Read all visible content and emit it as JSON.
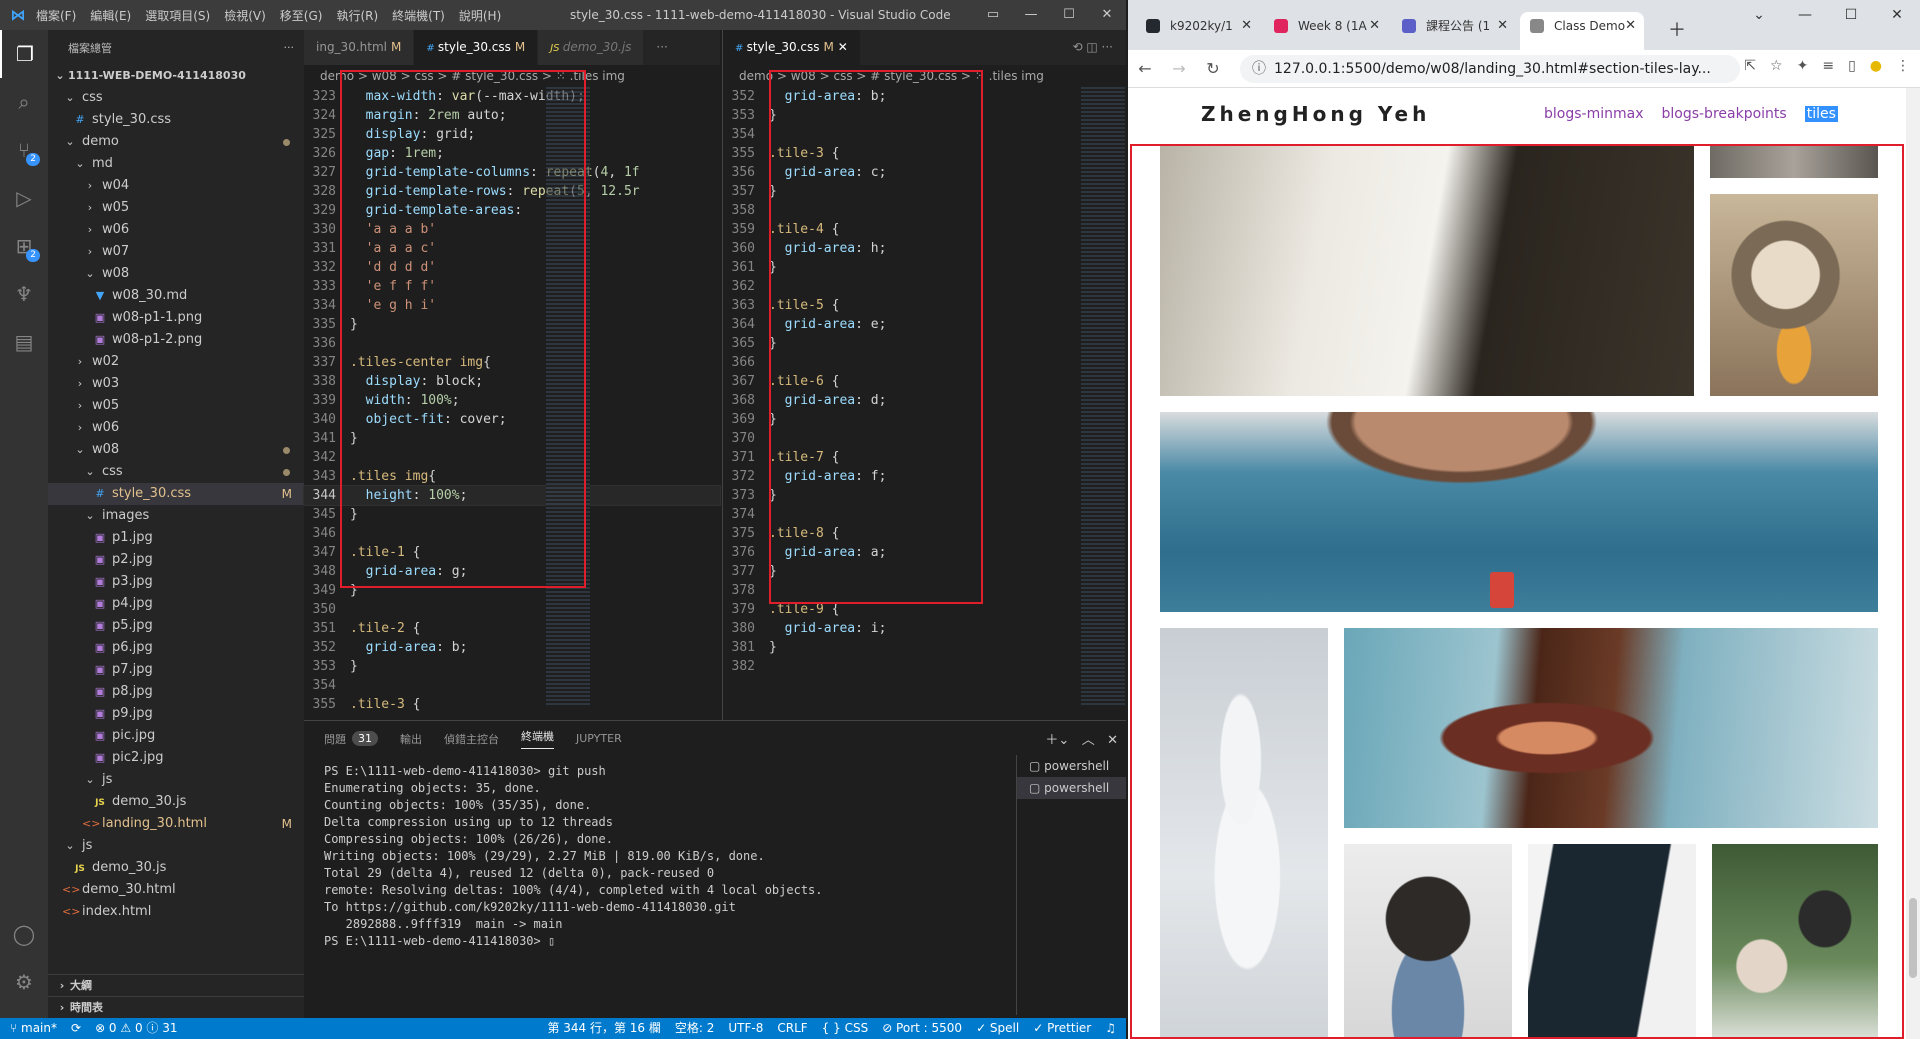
{
  "vscode": {
    "window_title": "style_30.css - 1111-web-demo-411418030 - Visual Studio Code",
    "menu": [
      "檔案(F)",
      "編輯(E)",
      "選取項目(S)",
      "檢視(V)",
      "移至(G)",
      "執行(R)",
      "終端機(T)",
      "說明(H)"
    ],
    "explorer_title": "檔案總管",
    "project": "1111-WEB-DEMO-411418030",
    "tree": [
      {
        "label": "css",
        "indent": 1,
        "type": "folder-open"
      },
      {
        "label": "style_30.css",
        "indent": 2,
        "type": "css"
      },
      {
        "label": "demo",
        "indent": 1,
        "type": "folder-open",
        "dot": true
      },
      {
        "label": "md",
        "indent": 2,
        "type": "folder-open"
      },
      {
        "label": "w04",
        "indent": 3,
        "type": "folder"
      },
      {
        "label": "w05",
        "indent": 3,
        "type": "folder"
      },
      {
        "label": "w06",
        "indent": 3,
        "type": "folder"
      },
      {
        "label": "w07",
        "indent": 3,
        "type": "folder"
      },
      {
        "label": "w08",
        "indent": 3,
        "type": "folder-open"
      },
      {
        "label": "w08_30.md",
        "indent": 4,
        "type": "md"
      },
      {
        "label": "w08-p1-1.png",
        "indent": 4,
        "type": "img"
      },
      {
        "label": "w08-p1-2.png",
        "indent": 4,
        "type": "img"
      },
      {
        "label": "w02",
        "indent": 2,
        "type": "folder"
      },
      {
        "label": "w03",
        "indent": 2,
        "type": "folder"
      },
      {
        "label": "w05",
        "indent": 2,
        "type": "folder"
      },
      {
        "label": "w06",
        "indent": 2,
        "type": "folder"
      },
      {
        "label": "w08",
        "indent": 2,
        "type": "folder-open",
        "dot": true
      },
      {
        "label": "css",
        "indent": 3,
        "type": "folder-open",
        "dot": true
      },
      {
        "label": "style_30.css",
        "indent": 4,
        "type": "css",
        "selected": true,
        "mark": "M"
      },
      {
        "label": "images",
        "indent": 3,
        "type": "folder-open"
      },
      {
        "label": "p1.jpg",
        "indent": 4,
        "type": "img"
      },
      {
        "label": "p2.jpg",
        "indent": 4,
        "type": "img"
      },
      {
        "label": "p3.jpg",
        "indent": 4,
        "type": "img"
      },
      {
        "label": "p4.jpg",
        "indent": 4,
        "type": "img"
      },
      {
        "label": "p5.jpg",
        "indent": 4,
        "type": "img"
      },
      {
        "label": "p6.jpg",
        "indent": 4,
        "type": "img"
      },
      {
        "label": "p7.jpg",
        "indent": 4,
        "type": "img"
      },
      {
        "label": "p8.jpg",
        "indent": 4,
        "type": "img"
      },
      {
        "label": "p9.jpg",
        "indent": 4,
        "type": "img"
      },
      {
        "label": "pic.jpg",
        "indent": 4,
        "type": "img"
      },
      {
        "label": "pic2.jpg",
        "indent": 4,
        "type": "img"
      },
      {
        "label": "js",
        "indent": 3,
        "type": "folder-open"
      },
      {
        "label": "demo_30.js",
        "indent": 4,
        "type": "js"
      },
      {
        "label": "landing_30.html",
        "indent": 3,
        "type": "html",
        "mark": "M"
      },
      {
        "label": "js",
        "indent": 1,
        "type": "folder-open"
      },
      {
        "label": "demo_30.js",
        "indent": 2,
        "type": "js"
      },
      {
        "label": "demo_30.html",
        "indent": 1,
        "type": "html"
      },
      {
        "label": "index.html",
        "indent": 1,
        "type": "html"
      }
    ],
    "footer_sections": [
      "大綱",
      "時間表"
    ],
    "editor1": {
      "tabs": [
        {
          "label": "ing_30.html",
          "mark": "M",
          "active": false
        },
        {
          "label": "style_30.css",
          "mark": "M",
          "active": true,
          "icon": "#"
        },
        {
          "label": "demo_30.js",
          "mark": "",
          "active": false,
          "js": true,
          "icon": "JS"
        }
      ],
      "breadcrumb": "demo  >  w08  >  css  >  #  style_30.css  >  ⁙ .tiles img",
      "lines": [
        [
          "323",
          "  max-width: var(--max-width);"
        ],
        [
          "324",
          "  margin: 2rem auto;"
        ],
        [
          "325",
          "  display: grid;"
        ],
        [
          "326",
          "  gap: 1rem;"
        ],
        [
          "327",
          "  grid-template-columns: repeat(4, 1f"
        ],
        [
          "328",
          "  grid-template-rows: repeat(5, 12.5r"
        ],
        [
          "329",
          "  grid-template-areas:"
        ],
        [
          "330",
          "  'a a a b'"
        ],
        [
          "331",
          "  'a a a c'"
        ],
        [
          "332",
          "  'd d d d'"
        ],
        [
          "333",
          "  'e f f f'"
        ],
        [
          "334",
          "  'e g h i'"
        ],
        [
          "335",
          "}"
        ],
        [
          "336",
          ""
        ],
        [
          "337",
          ".tiles-center img{"
        ],
        [
          "338",
          "  display: block;"
        ],
        [
          "339",
          "  width: 100%;"
        ],
        [
          "340",
          "  object-fit: cover;"
        ],
        [
          "341",
          "}"
        ],
        [
          "342",
          ""
        ],
        [
          "343",
          ".tiles img{"
        ],
        [
          "344",
          "  height: 100%;"
        ],
        [
          "345",
          "}"
        ],
        [
          "346",
          ""
        ],
        [
          "347",
          ".tile-1 {"
        ],
        [
          "348",
          "  grid-area: g;"
        ],
        [
          "349",
          "}"
        ],
        [
          "350",
          ""
        ],
        [
          "351",
          ".tile-2 {"
        ],
        [
          "352",
          "  grid-area: b;"
        ],
        [
          "353",
          "}"
        ],
        [
          "354",
          ""
        ],
        [
          "355",
          ".tile-3 {"
        ]
      ]
    },
    "editor2": {
      "tabs": [
        {
          "label": "style_30.css",
          "mark": "M",
          "active": true,
          "icon": "#"
        }
      ],
      "breadcrumb": "demo  >  w08  >  css  >  #  style_30.css  >  ⁙ .tiles img",
      "lines": [
        [
          "352",
          "  grid-area: b;"
        ],
        [
          "353",
          "}"
        ],
        [
          "354",
          ""
        ],
        [
          "355",
          ".tile-3 {"
        ],
        [
          "356",
          "  grid-area: c;"
        ],
        [
          "357",
          "}"
        ],
        [
          "358",
          ""
        ],
        [
          "359",
          ".tile-4 {"
        ],
        [
          "360",
          "  grid-area: h;"
        ],
        [
          "361",
          "}"
        ],
        [
          "362",
          ""
        ],
        [
          "363",
          ".tile-5 {"
        ],
        [
          "364",
          "  grid-area: e;"
        ],
        [
          "365",
          "}"
        ],
        [
          "366",
          ""
        ],
        [
          "367",
          ".tile-6 {"
        ],
        [
          "368",
          "  grid-area: d;"
        ],
        [
          "369",
          "}"
        ],
        [
          "370",
          ""
        ],
        [
          "371",
          ".tile-7 {"
        ],
        [
          "372",
          "  grid-area: f;"
        ],
        [
          "373",
          "}"
        ],
        [
          "374",
          ""
        ],
        [
          "375",
          ".tile-8 {"
        ],
        [
          "376",
          "  grid-area: a;"
        ],
        [
          "377",
          "}"
        ],
        [
          "378",
          ""
        ],
        [
          "379",
          ".tile-9 {"
        ],
        [
          "380",
          "  grid-area: i;"
        ],
        [
          "381",
          "}"
        ],
        [
          "382",
          ""
        ]
      ]
    },
    "panel": {
      "tabs": [
        "問題",
        "輸出",
        "偵錯主控台",
        "終端機",
        "JUPYTER"
      ],
      "problem_count": "31",
      "active_tab": "終端機",
      "shells": [
        "powershell",
        "powershell"
      ],
      "terminal": [
        "PS E:\\1111-web-demo-411418030> git push",
        "Enumerating objects: 35, done.",
        "Counting objects: 100% (35/35), done.",
        "Delta compression using up to 12 threads",
        "Compressing objects: 100% (26/26), done.",
        "Writing objects: 100% (29/29), 2.27 MiB | 819.00 KiB/s, done.",
        "Total 29 (delta 4), reused 12 (delta 0), pack-reused 0",
        "remote: Resolving deltas: 100% (4/4), completed with 4 local objects.",
        "To https://github.com/k9202ky/1111-web-demo-411418030.git",
        "   2892888..9fff319  main -> main",
        "PS E:\\1111-web-demo-411418030> ▯"
      ]
    },
    "status": {
      "branch": "main*",
      "errors": "⊗ 0 ⚠ 0 ⓘ 31",
      "position": "第 344 行，第 16 欄",
      "spaces": "空格: 2",
      "encoding": "UTF-8",
      "eol": "CRLF",
      "lang": "{ } CSS",
      "port": "⊘ Port : 5500",
      "spell": "✓ Spell",
      "prettier": "✓ Prettier"
    }
  },
  "browser": {
    "tabs": [
      {
        "label": "k9202ky/1",
        "color": "#24292f"
      },
      {
        "label": "Week 8 (1A",
        "color": "#e0245e"
      },
      {
        "label": "課程公告 (1",
        "color": "#5b5fc7"
      },
      {
        "label": "Class Demo",
        "color": "#888",
        "active": true
      }
    ],
    "url": "127.0.0.1:5500/demo/w08/landing_30.html#section-tiles-lay...",
    "site": {
      "brand": "ZhengHong Yeh",
      "nav": [
        "blogs-minmax",
        "blogs-breakpoints",
        "tiles"
      ]
    }
  }
}
